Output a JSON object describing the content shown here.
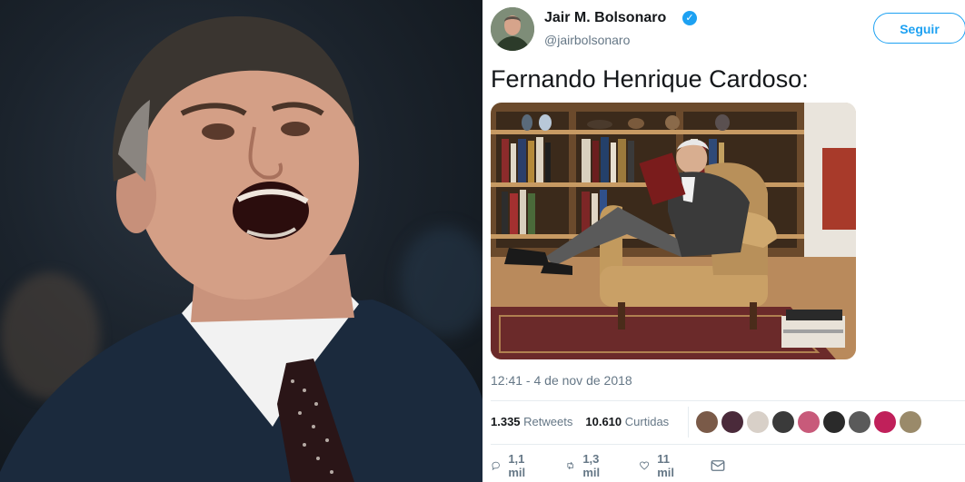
{
  "profile": {
    "name": "Jair M. Bolsonaro",
    "handle": "@jairbolsonaro",
    "verified_icon": "verified-badge-icon"
  },
  "follow_button": {
    "label": "Seguir"
  },
  "tweet": {
    "text": "Fernando Henrique Cardoso:",
    "timestamp": "12:41 - 4 de nov de 2018"
  },
  "stats": {
    "retweets_count": "1.335",
    "retweets_label": "Retweets",
    "likes_count": "10.610",
    "likes_label": "Curtidas"
  },
  "actions": {
    "reply_count": "1,1 mil",
    "retweet_count": "1,3 mil",
    "like_count": "11 mil"
  },
  "colors": {
    "accent": "#1da1f2",
    "text": "#14171a",
    "secondary": "#657786",
    "divider": "#e6ecf0"
  }
}
